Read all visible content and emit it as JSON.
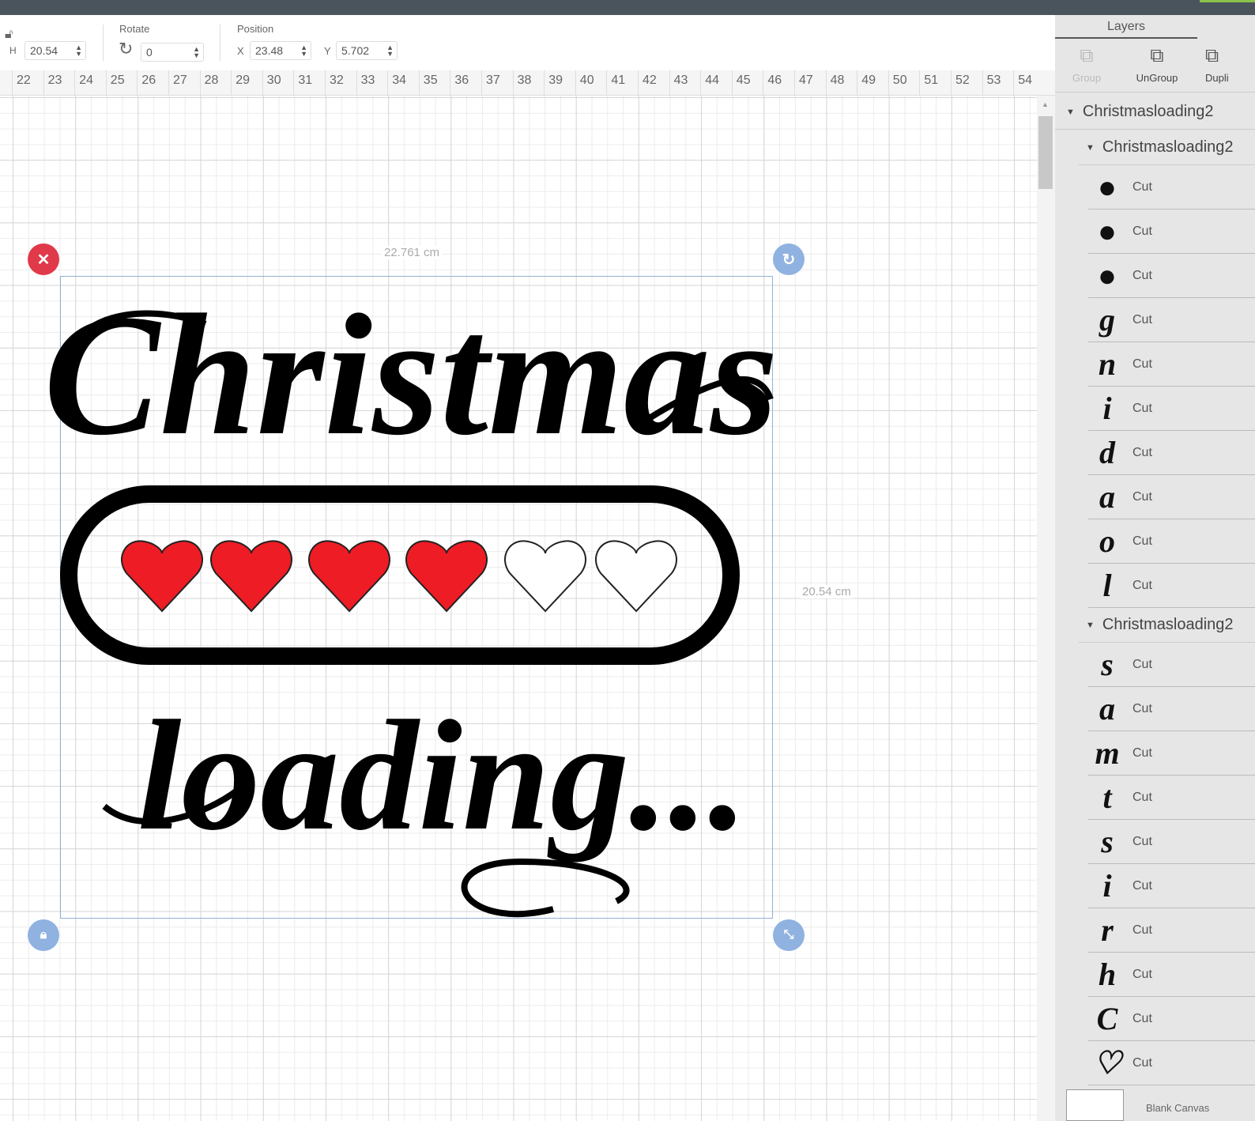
{
  "toolbar": {
    "h_label": "H",
    "h_value": "20.54",
    "rotate_label": "Rotate",
    "rotate_value": "0",
    "position_label": "Position",
    "x_label": "X",
    "x_value": "23.48",
    "y_label": "Y",
    "y_value": "5.702"
  },
  "ruler": {
    "ticks": [
      "22",
      "23",
      "24",
      "25",
      "26",
      "27",
      "28",
      "29",
      "30",
      "31",
      "32",
      "33",
      "34",
      "35",
      "36",
      "37",
      "38",
      "39",
      "40",
      "41",
      "42",
      "43",
      "44",
      "45",
      "46",
      "47",
      "48",
      "49",
      "50",
      "51",
      "52",
      "53",
      "54"
    ]
  },
  "canvas": {
    "width_dim": "22.761 cm",
    "height_dim": "20.54 cm",
    "design": {
      "title": "Christmas",
      "subtitle": "loading...",
      "hearts_filled": 4,
      "hearts_total": 6,
      "heart_color": "#ee1c24"
    }
  },
  "layers": {
    "title": "Layers",
    "buttons": {
      "group": "Group",
      "ungroup": "UnGroup",
      "duplicate": "Dupli"
    },
    "root": "Christmasloading2",
    "groups": [
      {
        "name": "Christmasloading2",
        "items": [
          {
            "glyph": "●",
            "op": "Cut"
          },
          {
            "glyph": "●",
            "op": "Cut"
          },
          {
            "glyph": "●",
            "op": "Cut"
          },
          {
            "glyph": "g",
            "op": "Cut"
          },
          {
            "glyph": "n",
            "op": "Cut"
          },
          {
            "glyph": "i",
            "op": "Cut"
          },
          {
            "glyph": "d",
            "op": "Cut"
          },
          {
            "glyph": "a",
            "op": "Cut"
          },
          {
            "glyph": "o",
            "op": "Cut"
          },
          {
            "glyph": "l",
            "op": "Cut"
          }
        ]
      },
      {
        "name": "Christmasloading2",
        "items": [
          {
            "glyph": "s",
            "op": "Cut"
          },
          {
            "glyph": "a",
            "op": "Cut"
          },
          {
            "glyph": "m",
            "op": "Cut"
          },
          {
            "glyph": "t",
            "op": "Cut"
          },
          {
            "glyph": "s",
            "op": "Cut"
          },
          {
            "glyph": "i",
            "op": "Cut"
          },
          {
            "glyph": "r",
            "op": "Cut"
          },
          {
            "glyph": "h",
            "op": "Cut"
          },
          {
            "glyph": "C",
            "op": "Cut"
          },
          {
            "glyph": "♡",
            "op": "Cut"
          }
        ]
      }
    ],
    "blank_canvas": "Blank Canvas"
  }
}
